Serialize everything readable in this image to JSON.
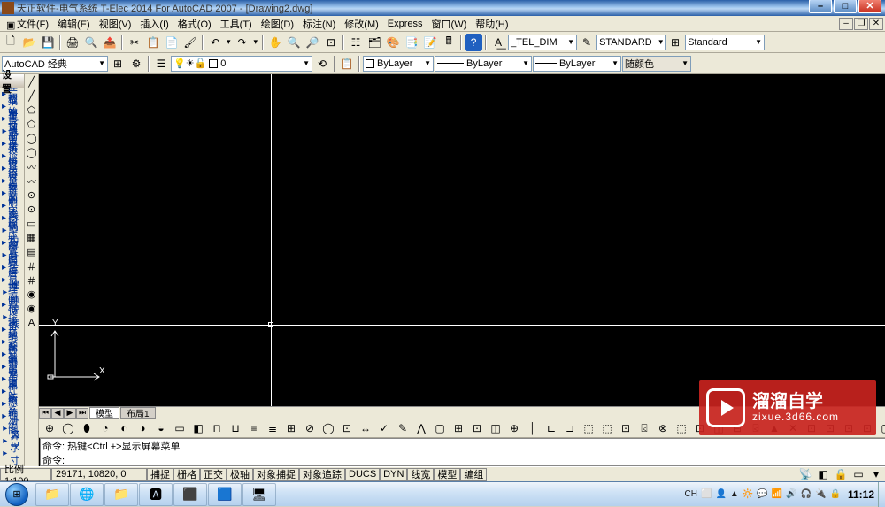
{
  "title": "天正软件-电气系统 T-Elec 2014  For AutoCAD 2007 - [Drawing2.dwg]",
  "menus": [
    "文件(F)",
    "编辑(E)",
    "视图(V)",
    "插入(I)",
    "格式(O)",
    "工具(T)",
    "绘图(D)",
    "标注(N)",
    "修改(M)",
    "Express",
    "窗口(W)",
    "帮助(H)"
  ],
  "tb1": {
    "dimstyle": "_TEL_DIM",
    "textstyle": "STANDARD",
    "tablestyle": "Standard"
  },
  "tb2": {
    "workspace": "AutoCAD 经典",
    "layer_state": "",
    "layer": "0",
    "linetype_left": "ByLayer",
    "color": "ByLayer",
    "linetype": "ByLayer",
    "color2": "随颜色"
  },
  "telec": {
    "head": "设 置",
    "items": [
      {
        "label": "工业菜单"
      },
      {
        "label": "工程管理"
      },
      {
        "label": "初始设置"
      },
      {
        "label": "工具条"
      },
      {
        "label": "导出设置"
      },
      {
        "label": "导入设置"
      },
      {
        "label": "楼层设置"
      },
      {
        "label": "楼层复制"
      },
      {
        "label": "依线正交"
      },
      {
        "label": "当前比例"
      },
      {
        "label": "文字样式"
      },
      {
        "label": "线型库"
      },
      {
        "label": "图库管理"
      },
      {
        "label": "构件库"
      },
      {
        "label": "图层管理"
      },
      {
        "label": "图层控制"
      },
      {
        "label": "建   筑"
      },
      {
        "label": "平面设备"
      },
      {
        "label": "导   线"
      },
      {
        "label": "标注统计"
      },
      {
        "label": "接地防雷"
      },
      {
        "label": "变配电室"
      },
      {
        "label": "系统元件"
      },
      {
        "label": "强电系统"
      },
      {
        "label": "弱电系统"
      },
      {
        "label": "消防系统"
      },
      {
        "label": "原 理 图"
      },
      {
        "label": "计   算"
      },
      {
        "label": "文   字"
      },
      {
        "label": "尺   寸"
      }
    ]
  },
  "leftstrip": [
    "╱",
    "╱",
    "⬠",
    "⬠",
    "◯",
    "◯",
    "〰",
    "〰",
    "⊙",
    "⊙",
    "▭",
    "▦",
    "▤",
    "＃",
    "＃",
    "◉",
    "◉",
    "A"
  ],
  "rightstrip": [
    "✎",
    "°",
    "⊕",
    "△",
    "⊞",
    "↔",
    "↗",
    "⊡",
    "⟳",
    "□",
    "▭",
    "—",
    "╱",
    "÷",
    "✂",
    "⌐",
    "▫",
    "⋯",
    "↘"
  ],
  "mtabs": {
    "nav": [
      "⏮",
      "◀",
      "▶",
      "⏭"
    ],
    "tabs": [
      "模型",
      "布局1"
    ]
  },
  "btoolbar": [
    "⊕",
    "◯",
    "⬮",
    "◔",
    "◐",
    "◑",
    "◒",
    "▭",
    "◧",
    "⊓",
    "⊔",
    "≡",
    "≣",
    "⊞",
    "⊘",
    "◯",
    "⊡",
    "↔",
    "✓",
    "✎",
    "⋀",
    "▢",
    "⊞",
    "⊡",
    "◫",
    "⊕",
    "│",
    "⊏",
    "⊐",
    "⬚",
    "⬚",
    "⊡",
    "⍃",
    "⊗",
    "⬚",
    "⊡",
    "◫",
    "⊟",
    "⍃",
    "▲",
    "✕",
    "⊡",
    "⊡",
    "⊡",
    "⊡",
    "▢",
    "▭",
    "⊡"
  ],
  "cmd": {
    "line1": "命令: 热键<Ctrl +>显示屏幕菜单",
    "prompt": "命令:"
  },
  "status": {
    "scale": "比例 1:100",
    "coords": "29171, 10820, 0",
    "toggles": [
      "捕捉",
      "栅格",
      "正交",
      "极轴",
      "对象捕捉",
      "对象追踪",
      "DUCS",
      "DYN",
      "线宽",
      "模型",
      "编组"
    ]
  },
  "watermark": {
    "big": "溜溜自学",
    "small": "zixue.3d66.com"
  },
  "taskbar": {
    "tasks": [
      "📁",
      "🌐",
      "📁",
      "🅰",
      "⬛",
      "🟦",
      "🖥"
    ],
    "tray": [
      "CH",
      "⬜",
      "👤",
      "▲",
      "🔆",
      "💬",
      "📶",
      "🔊",
      "🎧",
      "🔌",
      "🔒"
    ],
    "clock": "11:12"
  }
}
